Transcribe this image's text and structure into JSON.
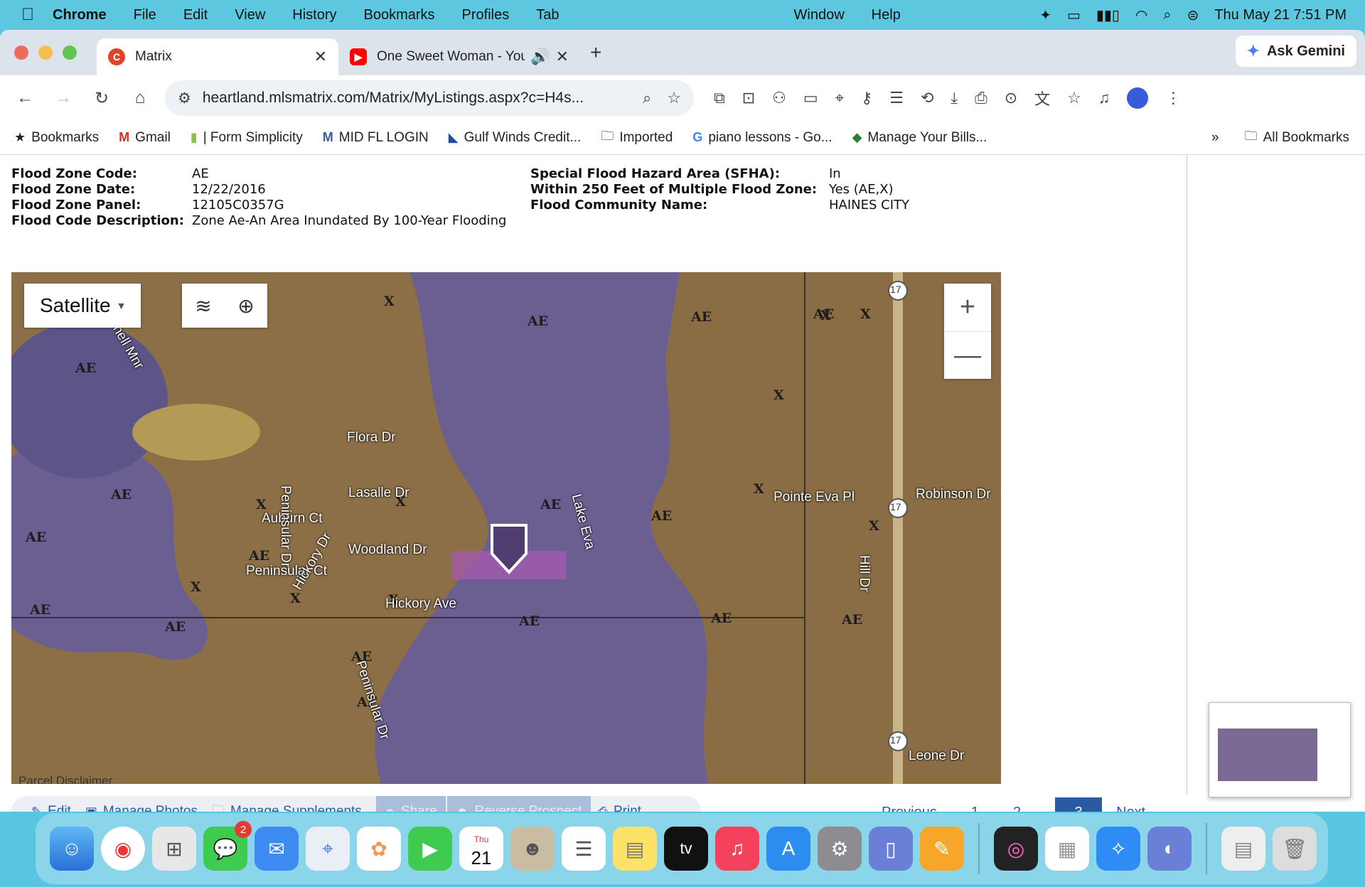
{
  "menubar": {
    "app": "Chrome",
    "items": [
      "File",
      "Edit",
      "View",
      "History",
      "Bookmarks",
      "Profiles",
      "Tab",
      "Window",
      "Help"
    ],
    "clock": "Thu May 21  7:51 PM"
  },
  "tabs": [
    {
      "title": "Matrix",
      "favicon_color": "#e0452b",
      "active": true
    },
    {
      "title": "One Sweet Woman - YouT",
      "favicon_color": "#ff0000",
      "active": false
    }
  ],
  "ask_gemini": "Ask Gemini",
  "address": {
    "url": "heartland.mlsmatrix.com/Matrix/MyListings.aspx?c=H4s..."
  },
  "bookmarks": {
    "items": [
      "Bookmarks",
      "Gmail",
      "| Form Simplicity",
      "MID FL LOGIN",
      "Gulf Winds Credit...",
      "Imported",
      "piano lessons - Go...",
      "Manage Your Bills..."
    ],
    "more": "»",
    "all": "All Bookmarks"
  },
  "flood": {
    "left": [
      {
        "label": "Flood Zone Code:",
        "value": "AE"
      },
      {
        "label": "Flood Zone Date:",
        "value": "12/22/2016"
      },
      {
        "label": "Flood Zone Panel:",
        "value": "12105C0357G"
      },
      {
        "label": "Flood Code Description:",
        "value": "Zone Ae-An Area Inundated By 100-Year Flooding"
      }
    ],
    "right": [
      {
        "label": "Special Flood Hazard Area (SFHA):",
        "value": "In"
      },
      {
        "label": "Within 250 Feet of Multiple Flood Zone:",
        "value": "Yes (AE,X)"
      },
      {
        "label": "Flood Community Name:",
        "value": "HAINES CITY"
      }
    ]
  },
  "map": {
    "type_label": "Satellite",
    "zoom_in": "+",
    "zoom_out": "—",
    "disclaimer": "Parcel Disclaimer",
    "zone_labels": [
      "AE",
      "AE",
      "AE",
      "X",
      "AE",
      "AE",
      "AE",
      "AE",
      "AE",
      "AE",
      "X",
      "X",
      "X",
      "X",
      "X",
      "X",
      "X",
      "AE",
      "AE",
      "AE",
      "AE",
      "X",
      "AE",
      "AE",
      "X",
      "X",
      "AE"
    ],
    "streets": [
      "Flora Dr",
      "Lasalle Dr",
      "Auburn Ct",
      "Peninsular Dr",
      "Woodland Dr",
      "Peninsular Ct",
      "Hickory Dr",
      "Hickory Ave",
      "Lake Eva",
      "Pointe Eva Pl",
      "Robinson Dr",
      "Hill Dr",
      "Leone Dr",
      "Peninsular Dr",
      "Shell Mnr"
    ],
    "route_shields": [
      "17",
      "17",
      "17"
    ]
  },
  "actions": [
    {
      "label": "Edit",
      "disabled": false
    },
    {
      "label": "Manage Photos",
      "disabled": false
    },
    {
      "label": "Manage Supplements",
      "disabled": false
    },
    {
      "label": "Share",
      "disabled": true
    },
    {
      "label": "Reverse Prospect",
      "disabled": true
    },
    {
      "label": "Print",
      "disabled": false
    }
  ],
  "pager": {
    "previous": "Previous",
    "pages": [
      "1",
      "2",
      "3"
    ],
    "current": "3",
    "next": "Next"
  },
  "dock": {
    "messages_badge": "2",
    "calendar_day": "21",
    "calendar_month": "Thu",
    "tv_label": "tv"
  }
}
